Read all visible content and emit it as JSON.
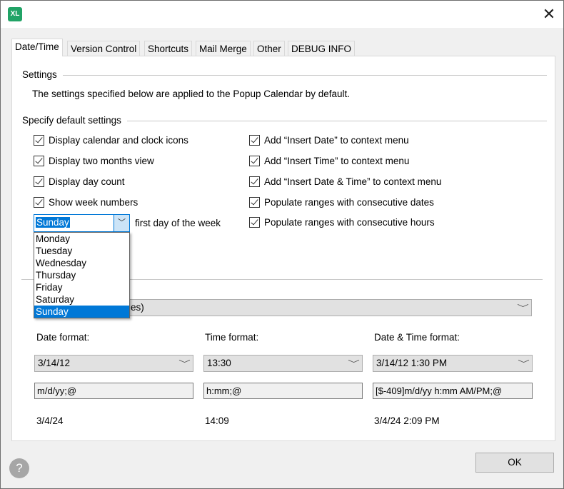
{
  "window": {
    "logo": "XL",
    "close": "✕"
  },
  "tabs": [
    "Date/Time",
    "Version Control",
    "Shortcuts",
    "Mail Merge",
    "Other",
    "DEBUG INFO"
  ],
  "settings": {
    "header": "Settings",
    "description": "The settings specified below are applied to the Popup Calendar by default."
  },
  "defaults": {
    "header": "Specify default settings",
    "left": [
      "Display calendar and clock icons",
      "Display two months view",
      "Display day count",
      "Show week numbers"
    ],
    "right": [
      "Add “Insert Date” to context menu",
      "Add “Insert Time” to context menu",
      "Add “Insert Date & Time” to context menu",
      "Populate ranges with consecutive dates",
      "Populate ranges with consecutive hours"
    ],
    "first_day": {
      "value": "Sunday",
      "label": "first day of the week",
      "options": [
        "Monday",
        "Tuesday",
        "Wednesday",
        "Thursday",
        "Friday",
        "Saturday",
        "Sunday"
      ]
    }
  },
  "locale_combo": "es)",
  "formats": [
    {
      "label": "Date format:",
      "combo": "3/14/12",
      "code": "m/d/yy;@",
      "preview": "3/4/24"
    },
    {
      "label": "Time format:",
      "combo": "13:30",
      "code": "h:mm;@",
      "preview": "14:09"
    },
    {
      "label": "Date & Time format:",
      "combo": "3/14/12 1:30 PM",
      "code": "[$-409]m/d/yy h:mm AM/PM;@",
      "preview": "3/4/24 2:09 PM"
    }
  ],
  "buttons": {
    "ok": "OK",
    "help": "?"
  },
  "chev": "﹀"
}
